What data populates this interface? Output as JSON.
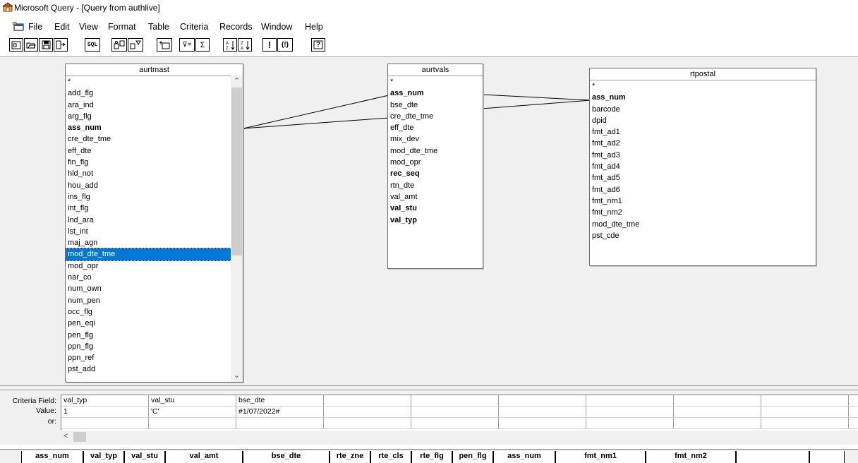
{
  "window": {
    "title": "Microsoft Query - [Query from authlive]"
  },
  "menu": [
    "File",
    "Edit",
    "View",
    "Format",
    "Table",
    "Criteria",
    "Records",
    "Window",
    "Help"
  ],
  "toolbar": {
    "sql_label": "SQL",
    "criteria_equals_label": "⊽=",
    "sum_label": "Σ",
    "query_now_label": "!",
    "auto_query_label": "(!)",
    "help_label": "?"
  },
  "tables": [
    {
      "name": "aurtmast",
      "fields": [
        {
          "name": "*",
          "bold": false
        },
        {
          "name": "add_flg",
          "bold": false
        },
        {
          "name": "ara_ind",
          "bold": false
        },
        {
          "name": "arg_flg",
          "bold": false
        },
        {
          "name": "ass_num",
          "bold": true
        },
        {
          "name": "cre_dte_tme",
          "bold": false
        },
        {
          "name": "eff_dte",
          "bold": false
        },
        {
          "name": "fin_flg",
          "bold": false
        },
        {
          "name": "hld_not",
          "bold": false
        },
        {
          "name": "hou_add",
          "bold": false
        },
        {
          "name": "ins_flg",
          "bold": false
        },
        {
          "name": "int_flg",
          "bold": false
        },
        {
          "name": "lnd_ara",
          "bold": false
        },
        {
          "name": "lst_int",
          "bold": false
        },
        {
          "name": "maj_agn",
          "bold": false
        },
        {
          "name": "mod_dte_tme",
          "bold": false,
          "selected": true
        },
        {
          "name": "mod_opr",
          "bold": false
        },
        {
          "name": "nar_co",
          "bold": false
        },
        {
          "name": "num_own",
          "bold": false
        },
        {
          "name": "num_pen",
          "bold": false
        },
        {
          "name": "occ_flg",
          "bold": false
        },
        {
          "name": "pen_eqi",
          "bold": false
        },
        {
          "name": "pen_flg",
          "bold": false
        },
        {
          "name": "ppn_flg",
          "bold": false
        },
        {
          "name": "ppn_ref",
          "bold": false
        },
        {
          "name": "pst_add",
          "bold": false
        }
      ]
    },
    {
      "name": "aurtvals",
      "fields": [
        {
          "name": "*",
          "bold": false
        },
        {
          "name": "ass_num",
          "bold": true
        },
        {
          "name": "bse_dte",
          "bold": false
        },
        {
          "name": "cre_dte_tme",
          "bold": false
        },
        {
          "name": "eff_dte",
          "bold": false
        },
        {
          "name": "mix_dev",
          "bold": false
        },
        {
          "name": "mod_dte_tme",
          "bold": false
        },
        {
          "name": "mod_opr",
          "bold": false
        },
        {
          "name": "rec_seq",
          "bold": true
        },
        {
          "name": "rtn_dte",
          "bold": false
        },
        {
          "name": "val_amt",
          "bold": false
        },
        {
          "name": "val_stu",
          "bold": true
        },
        {
          "name": "val_typ",
          "bold": true
        }
      ]
    },
    {
      "name": "rtpostal",
      "fields": [
        {
          "name": "*",
          "bold": false
        },
        {
          "name": "ass_num",
          "bold": true
        },
        {
          "name": "barcode",
          "bold": false
        },
        {
          "name": "dpid",
          "bold": false
        },
        {
          "name": "fmt_ad1",
          "bold": false
        },
        {
          "name": "fmt_ad2",
          "bold": false
        },
        {
          "name": "fmt_ad3",
          "bold": false
        },
        {
          "name": "fmt_ad4",
          "bold": false
        },
        {
          "name": "fmt_ad5",
          "bold": false
        },
        {
          "name": "fmt_ad6",
          "bold": false
        },
        {
          "name": "fmt_nm1",
          "bold": false
        },
        {
          "name": "fmt_nm2",
          "bold": false
        },
        {
          "name": "mod_dte_tme",
          "bold": false
        },
        {
          "name": "pst_cde",
          "bold": false
        }
      ]
    }
  ],
  "criteria": {
    "row_labels": [
      "Criteria Field:",
      "Value:",
      "or:"
    ],
    "fields": [
      "val_typ",
      "val_stu",
      "bse_dte",
      "",
      "",
      "",
      "",
      "",
      "",
      ""
    ],
    "values": [
      "1",
      "'C'",
      "#1/07/2022#",
      "",
      "",
      "",
      "",
      "",
      "",
      ""
    ],
    "or_values": [
      "",
      "",
      "",
      "",
      "",
      "",
      "",
      "",
      "",
      ""
    ]
  },
  "results": {
    "columns": [
      "ass_num",
      "val_typ",
      "val_stu",
      "val_amt",
      "bse_dte",
      "rte_zne",
      "rte_cls",
      "rte_flg",
      "pen_flg",
      "ass_num",
      "fmt_nm1",
      "fmt_nm2",
      "",
      ""
    ]
  }
}
